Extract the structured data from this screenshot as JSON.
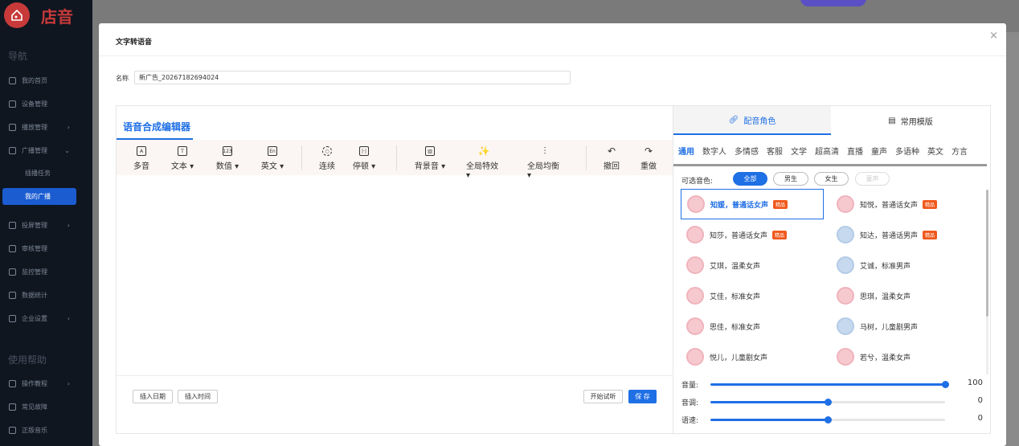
{
  "app": {
    "logo_text": "店音"
  },
  "sidebar": {
    "nav_heading": "导航",
    "items": [
      {
        "label": "我的首页",
        "chevron": ""
      },
      {
        "label": "设备管理",
        "chevron": ""
      },
      {
        "label": "播放管理",
        "chevron": "›"
      },
      {
        "label": "广播管理",
        "chevron": "⌄"
      }
    ],
    "sub_items": [
      {
        "label": "插播任务"
      },
      {
        "label": "我的广播"
      }
    ],
    "items2": [
      {
        "label": "投屏管理",
        "chevron": "›"
      },
      {
        "label": "审核管理",
        "chevron": ""
      },
      {
        "label": "监控管理",
        "chevron": ""
      },
      {
        "label": "数据统计",
        "chevron": ""
      },
      {
        "label": "企业设置",
        "chevron": "›"
      }
    ],
    "help_heading": "使用帮助",
    "help_items": [
      {
        "label": "操作教程",
        "chevron": "›"
      },
      {
        "label": "常见故障",
        "chevron": ""
      },
      {
        "label": "正版音乐",
        "chevron": ""
      }
    ]
  },
  "modal": {
    "title": "文字转语音",
    "close": "×",
    "name_label": "名称",
    "name_value": "新广告_20267182694024",
    "editor": {
      "title": "语音合成编辑器",
      "toolbar": [
        {
          "label": "多音",
          "icon": "A",
          "icon_name": "polyphone-icon"
        },
        {
          "label": "文本 ▾",
          "icon": "T",
          "icon_name": "text-icon"
        },
        {
          "label": "数值 ▾",
          "icon": "123",
          "icon_name": "number-icon"
        },
        {
          "label": "英文 ▾",
          "icon": "En",
          "icon_name": "english-icon"
        },
        {
          "label": "连续",
          "icon": "○",
          "icon_name": "continuous-icon"
        },
        {
          "label": "停顿 ▾",
          "icon": "|·|",
          "icon_name": "pause-icon"
        },
        {
          "label": "背景音 ▾",
          "icon": "▥",
          "icon_name": "background-music-icon"
        },
        {
          "label": "全局特效 ▾",
          "icon": "✨",
          "icon_name": "effects-icon"
        },
        {
          "label": "全局均衡 ▾",
          "icon": "⫶",
          "icon_name": "equalizer-icon"
        },
        {
          "label": "撤回",
          "icon": "↶",
          "icon_name": "undo-icon"
        },
        {
          "label": "重做",
          "icon": "↷",
          "icon_name": "redo-icon"
        }
      ],
      "insert_date": "插入日期",
      "insert_time": "插入时间",
      "preview": "开始试听",
      "save": "保 存"
    },
    "panel": {
      "tab_voice": "配音角色",
      "tab_template": "常用模版",
      "categories": [
        {
          "label": "通用"
        },
        {
          "label": "数字人"
        },
        {
          "label": "多情感"
        },
        {
          "label": "客服"
        },
        {
          "label": "文学"
        },
        {
          "label": "超高清"
        },
        {
          "label": "直播"
        },
        {
          "label": "童声"
        },
        {
          "label": "多语种"
        },
        {
          "label": "英文"
        },
        {
          "label": "方言"
        }
      ],
      "selectable_label": "可选音色:",
      "filters": [
        {
          "label": "全部"
        },
        {
          "label": "男生"
        },
        {
          "label": "女生"
        },
        {
          "label": "童声"
        }
      ],
      "voices": [
        {
          "name": "知媛，普通话女声",
          "badge": "精品",
          "gender": "f"
        },
        {
          "name": "知悦，普通话女声",
          "badge": "精品",
          "gender": "f"
        },
        {
          "name": "知莎，普通话女声",
          "badge": "精品",
          "gender": "f"
        },
        {
          "name": "知达，普通话男声",
          "badge": "精品",
          "gender": "m"
        },
        {
          "name": "艾琪，温柔女声",
          "badge": "",
          "gender": "f"
        },
        {
          "name": "艾诚，标准男声",
          "badge": "",
          "gender": "m"
        },
        {
          "name": "艾佳，标准女声",
          "badge": "",
          "gender": "f"
        },
        {
          "name": "思琪，温柔女声",
          "badge": "",
          "gender": "f"
        },
        {
          "name": "思佳，标准女声",
          "badge": "",
          "gender": "f"
        },
        {
          "name": "马树，儿童剧男声",
          "badge": "",
          "gender": "m"
        },
        {
          "name": "悦儿，儿童剧女声",
          "badge": "",
          "gender": "f"
        },
        {
          "name": "若兮，温柔女声",
          "badge": "",
          "gender": "f"
        }
      ],
      "sliders": [
        {
          "label": "音量:",
          "value": "100",
          "fill": 1.0
        },
        {
          "label": "音调:",
          "value": "0",
          "fill": 0.5
        },
        {
          "label": "语速:",
          "value": "0",
          "fill": 0.5
        }
      ]
    }
  },
  "colors": {
    "accent": "#1f6fe5",
    "brand": "#c83a3a",
    "badge": "#f05a1d"
  }
}
